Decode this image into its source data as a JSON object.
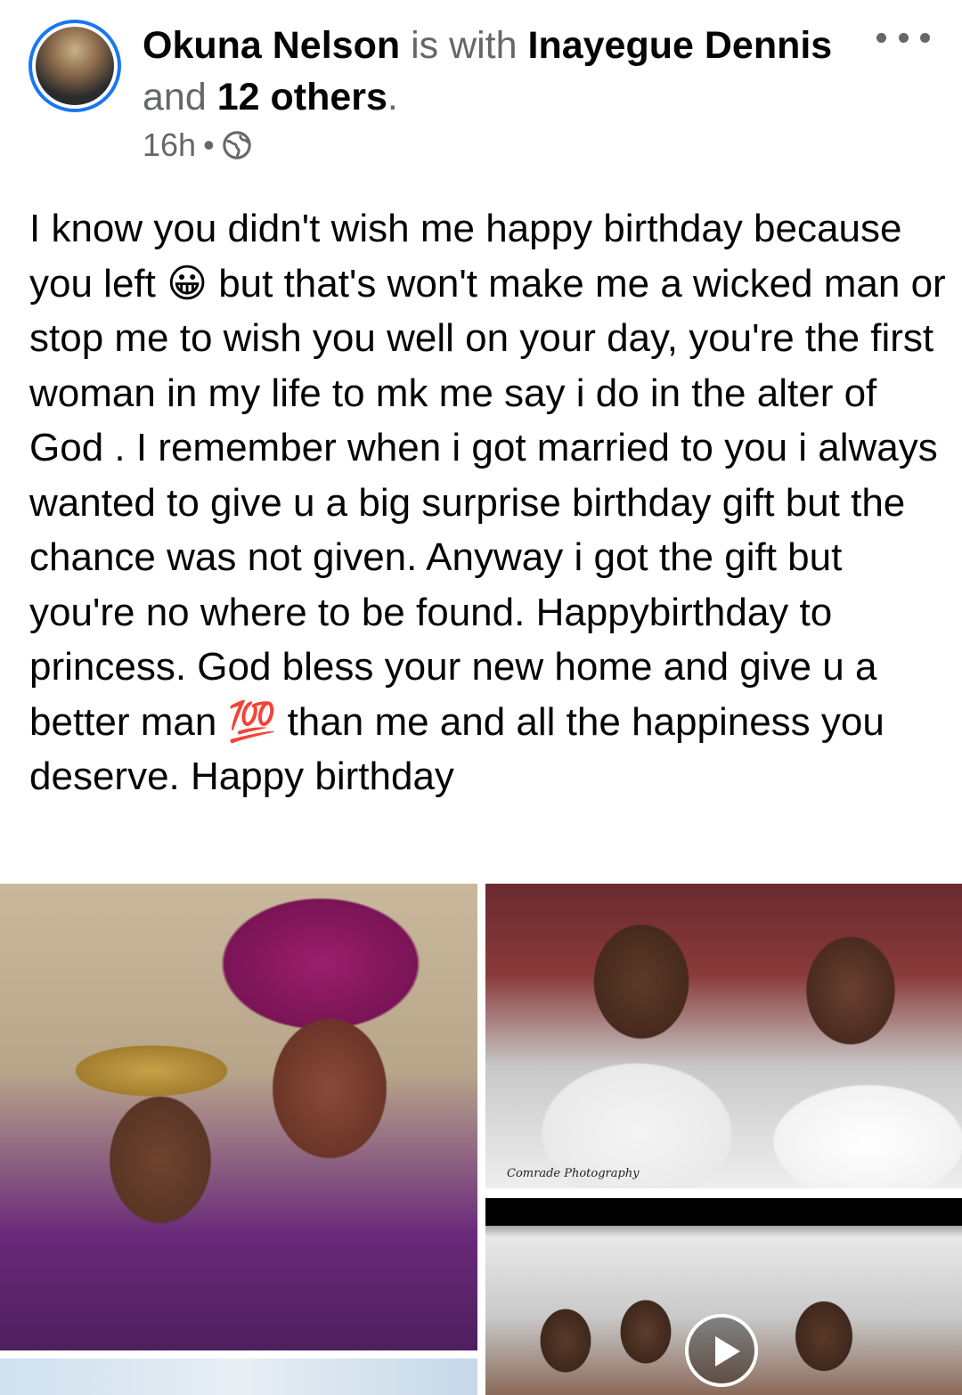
{
  "post": {
    "author": "Okuna Nelson",
    "is_with": "is with",
    "tagged": "Inayegue Dennis",
    "and": "and",
    "others": "12 others",
    "period": ".",
    "time": "16h",
    "separator": "•",
    "privacy_icon": "globe-icon",
    "more_icon": "more-options-icon",
    "text": {
      "part1": "I know you didn't wish me happy birthday because you left ",
      "emoji1": "😀",
      "part2": " but that's won't make me a wicked man or stop me to wish you well on your day, you're the first woman in my life to mk me say i do in the alter of God . I remember when i got married to you i always wanted to give u a big surprise birthday gift but the chance was not given. Anyway i got the gift but you're no where to be found. Happybirthday to princess. God bless your new  home and give u a better man ",
      "emoji2": "💯",
      "part3": " than me and all the happiness you deserve. Happy birthday"
    },
    "photo_watermark": "Comrade Photography"
  },
  "colors": {
    "accent": "#1877f2",
    "secondary_text": "#65676b",
    "primary_text": "#050505"
  }
}
